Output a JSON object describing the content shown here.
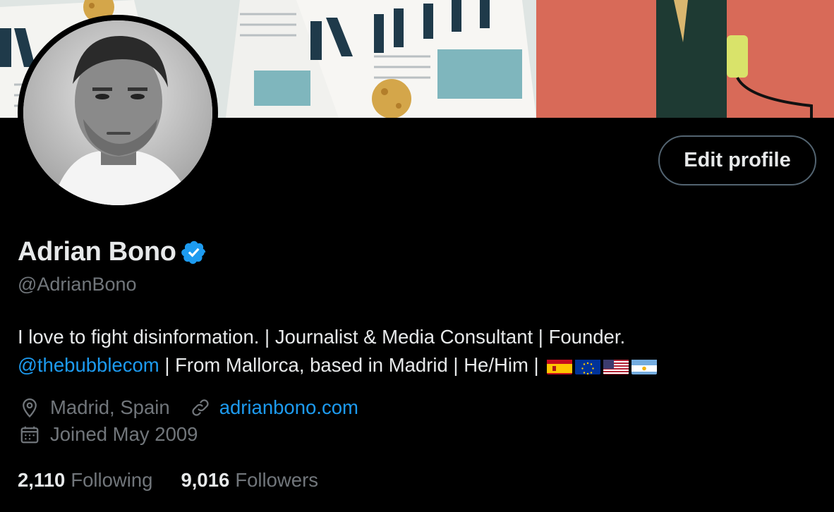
{
  "profile": {
    "name": "Adrian Bono",
    "handle": "@AdrianBono",
    "verified": true,
    "edit_label": "Edit profile",
    "bio": {
      "line1": "I love to fight disinformation. | Journalist & Media Consultant | Founder.",
      "mention": "@thebubblecom",
      "line2_rest": " | From Mallorca, based in Madrid | He/Him | ",
      "flags": [
        "spain-flag",
        "eu-flag",
        "us-flag",
        "argentina-flag"
      ]
    },
    "location": "Madrid, Spain",
    "website": "adrianbono.com",
    "joined": "Joined May 2009",
    "following_count": "2,110",
    "following_label": "Following",
    "followers_count": "9,016",
    "followers_label": "Followers"
  },
  "colors": {
    "background": "#000000",
    "text": "#e7e9ea",
    "secondary": "#71767b",
    "accent": "#1d9bf0",
    "verified": "#1d9bf0"
  },
  "icons": {
    "verified": "verified-badge-icon",
    "location": "location-pin-icon",
    "link": "link-icon",
    "calendar": "calendar-icon"
  }
}
